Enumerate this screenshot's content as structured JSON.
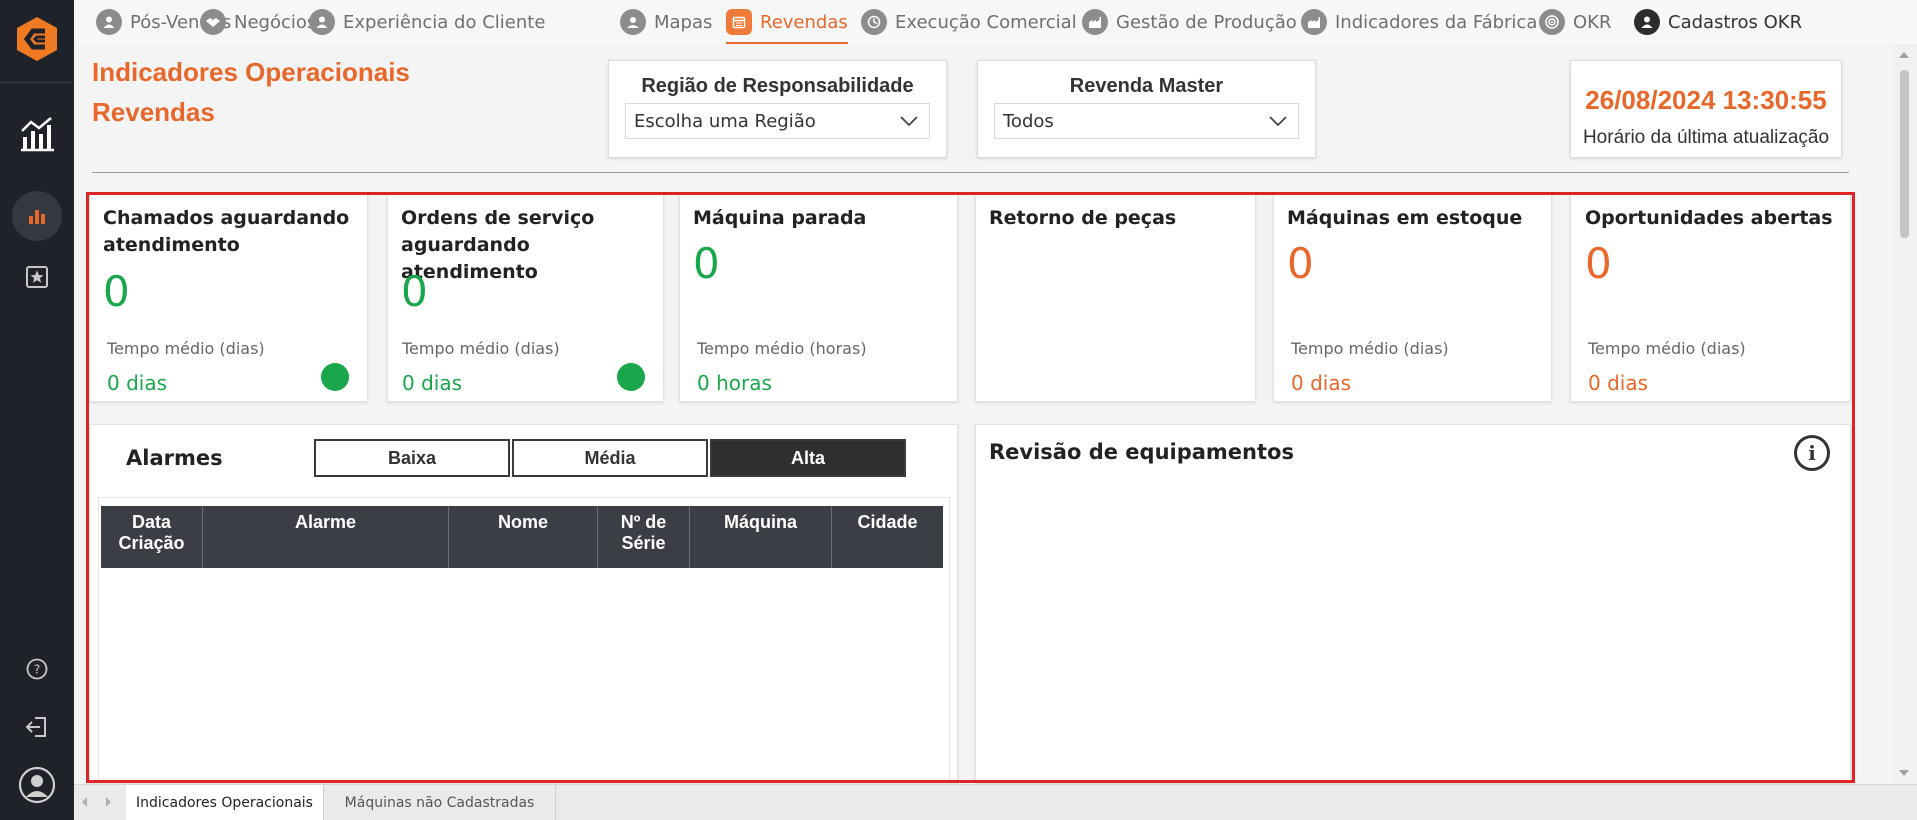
{
  "nav": {
    "items": [
      {
        "label": "Pós-Vendas",
        "icon": "user-icon",
        "state": "normal"
      },
      {
        "label": "Negócios",
        "icon": "handshake-icon",
        "state": "normal"
      },
      {
        "label": "Experiência do Cliente",
        "icon": "user-icon",
        "state": "normal"
      },
      {
        "label": "Mapas",
        "icon": "map-user-icon",
        "state": "normal"
      },
      {
        "label": "Revendas",
        "icon": "calendar-icon",
        "state": "active"
      },
      {
        "label": "Execução Comercial",
        "icon": "clock-icon",
        "state": "normal"
      },
      {
        "label": "Gestão de Produção",
        "icon": "factory-icon",
        "state": "normal"
      },
      {
        "label": "Indicadores da Fábrica",
        "icon": "factory-icon",
        "state": "normal"
      },
      {
        "label": "OKR",
        "icon": "target-icon",
        "state": "normal"
      },
      {
        "label": "Cadastros OKR",
        "icon": "user-icon",
        "state": "dark"
      }
    ]
  },
  "header": {
    "title_line1": "Indicadores Operacionais",
    "title_line2": "Revendas"
  },
  "filters": {
    "region": {
      "label": "Região de Responsabilidade",
      "value": "Escolha uma Região"
    },
    "master": {
      "label": "Revenda Master",
      "value": "Todos"
    }
  },
  "update": {
    "timestamp": "26/08/2024 13:30:55",
    "label": "Horário da última atualização"
  },
  "cards": [
    {
      "title": "Chamados aguardando atendimento",
      "value": "0",
      "sub": "Tempo médio (dias)",
      "avg": "0 dias",
      "color": "#1aa64b",
      "status_dot": true
    },
    {
      "title": "Ordens de serviço aguardando atendimento",
      "value": "0",
      "sub": "Tempo médio (dias)",
      "avg": "0 dias",
      "color": "#1aa64b",
      "status_dot": true
    },
    {
      "title": "Máquina parada",
      "value": "0",
      "sub": "Tempo médio (horas)",
      "avg": "0 horas",
      "color": "#1aa64b",
      "status_dot": false
    },
    {
      "title": "Retorno de peças",
      "value": "",
      "sub": "",
      "avg": "",
      "color": "#1aa64b",
      "status_dot": false
    },
    {
      "title": "Máquinas em estoque",
      "value": "0",
      "sub": "Tempo médio (dias)",
      "avg": "0 dias",
      "color": "#e8672a",
      "status_dot": false
    },
    {
      "title": "Oportunidades abertas",
      "value": "0",
      "sub": "Tempo médio (dias)",
      "avg": "0 dias",
      "color": "#e8672a",
      "status_dot": false
    }
  ],
  "alarms": {
    "title": "Alarmes",
    "priority_buttons": [
      "Baixa",
      "Média",
      "Alta"
    ],
    "active_priority": "Alta",
    "columns": [
      "Data Criação",
      "Alarme",
      "Nome",
      "Nº de Série",
      "Máquina",
      "Cidade"
    ]
  },
  "review": {
    "title": "Revisão de equipamentos",
    "info_glyph": "i"
  },
  "bottom_tabs": [
    {
      "label": "Indicadores Operacionais",
      "active": true
    },
    {
      "label": "Máquinas não Cadastradas",
      "active": false
    }
  ],
  "colors": {
    "accent": "#e8672a",
    "success": "#1aa64b",
    "sidebar": "#1f2228",
    "highlight": "#e02424"
  }
}
